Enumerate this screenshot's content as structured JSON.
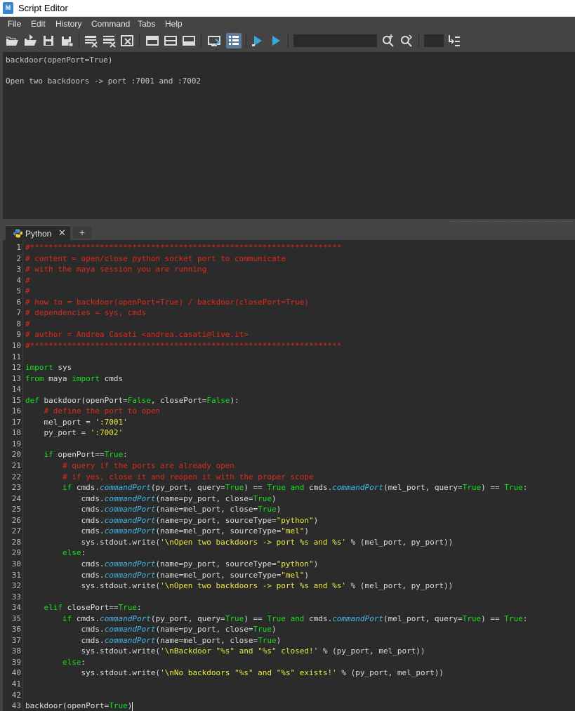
{
  "window": {
    "title": "Script Editor",
    "app_icon_letter": "M"
  },
  "menu": [
    "File",
    "Edit",
    "History",
    "Command",
    "Tabs",
    "Help"
  ],
  "toolbar": {
    "icons": [
      "open-script-icon",
      "source-script-icon",
      "save-script-icon",
      "save-as-icon",
      "clear-history-icon",
      "clear-input-icon",
      "clear-all-icon",
      "show-history-icon",
      "show-both-icon",
      "show-input-icon",
      "echo-all-commands-icon",
      "line-numbers-icon",
      "execute-all-icon",
      "execute-icon",
      "search-icon",
      "replace-icon",
      "goto-line-icon"
    ],
    "search_value": "",
    "goto_value": ""
  },
  "output": {
    "lines": [
      "backdoor(openPort=True)",
      "",
      "Open two backdoors -> port :7001 and :7002"
    ]
  },
  "tabs": {
    "active_label": "Python",
    "close_glyph": "✕",
    "add_glyph": "+"
  },
  "editor": {
    "line_numbers": [
      "1",
      "2",
      "3",
      "4",
      "5",
      "6",
      "7",
      "8",
      "9",
      "10",
      "11",
      "12",
      "13",
      "14",
      "15",
      "16",
      "17",
      "18",
      "19",
      "20",
      "21",
      "22",
      "23",
      "24",
      "25",
      "26",
      "27",
      "28",
      "29",
      "30",
      "31",
      "32",
      "33",
      "34",
      "35",
      "36",
      "37",
      "38",
      "39",
      "40",
      "41",
      "42",
      "43"
    ],
    "lines": [
      [
        [
          "c",
          "#*******************************************************************"
        ]
      ],
      [
        [
          "c",
          "# content = open/close python socket port to communicate"
        ]
      ],
      [
        [
          "c",
          "# with the maya session you are running"
        ]
      ],
      [
        [
          "c",
          "#"
        ]
      ],
      [
        [
          "c",
          "#"
        ]
      ],
      [
        [
          "c",
          "# how to = backdoor(openPort=True) / backdoor(closePort=True)"
        ]
      ],
      [
        [
          "c",
          "# dependencies = sys, cmds"
        ]
      ],
      [
        [
          "c",
          "#"
        ]
      ],
      [
        [
          "c",
          "# author = Andrea Casati <andrea.casati@live.it>"
        ]
      ],
      [
        [
          "c",
          "#*******************************************************************"
        ]
      ],
      [],
      [
        [
          "k",
          "import"
        ],
        [
          "t",
          " sys"
        ]
      ],
      [
        [
          "k",
          "from"
        ],
        [
          "t",
          " maya "
        ],
        [
          "k",
          "import"
        ],
        [
          "t",
          " cmds"
        ]
      ],
      [],
      [
        [
          "k",
          "def"
        ],
        [
          "t",
          " backdoor(openPort="
        ],
        [
          "k",
          "False"
        ],
        [
          "t",
          ", closePort="
        ],
        [
          "k",
          "False"
        ],
        [
          "t",
          "):"
        ]
      ],
      [
        [
          "t",
          "    "
        ],
        [
          "c",
          "# define the port to open"
        ]
      ],
      [
        [
          "t",
          "    mel_port = "
        ],
        [
          "s",
          "':7001'"
        ]
      ],
      [
        [
          "t",
          "    py_port = "
        ],
        [
          "s",
          "':7002'"
        ]
      ],
      [],
      [
        [
          "t",
          "    "
        ],
        [
          "k",
          "if"
        ],
        [
          "t",
          " openPort=="
        ],
        [
          "k",
          "True"
        ],
        [
          "t",
          ":"
        ]
      ],
      [
        [
          "t",
          "        "
        ],
        [
          "c",
          "# query if the ports are already open"
        ]
      ],
      [
        [
          "t",
          "        "
        ],
        [
          "c",
          "# if yes, close it and reopen it with the proper scope"
        ]
      ],
      [
        [
          "t",
          "        "
        ],
        [
          "k",
          "if"
        ],
        [
          "t",
          " cmds."
        ],
        [
          "f",
          "commandPort"
        ],
        [
          "t",
          "(py_port, query="
        ],
        [
          "k",
          "True"
        ],
        [
          "t",
          ") == "
        ],
        [
          "k",
          "True"
        ],
        [
          "t",
          " "
        ],
        [
          "k",
          "and"
        ],
        [
          "t",
          " cmds."
        ],
        [
          "f",
          "commandPort"
        ],
        [
          "t",
          "(mel_port, query="
        ],
        [
          "k",
          "True"
        ],
        [
          "t",
          ") == "
        ],
        [
          "k",
          "True"
        ],
        [
          "t",
          ":"
        ]
      ],
      [
        [
          "t",
          "            cmds."
        ],
        [
          "f",
          "commandPort"
        ],
        [
          "t",
          "(name=py_port, close="
        ],
        [
          "k",
          "True"
        ],
        [
          "t",
          ")"
        ]
      ],
      [
        [
          "t",
          "            cmds."
        ],
        [
          "f",
          "commandPort"
        ],
        [
          "t",
          "(name=mel_port, close="
        ],
        [
          "k",
          "True"
        ],
        [
          "t",
          ")"
        ]
      ],
      [
        [
          "t",
          "            cmds."
        ],
        [
          "f",
          "commandPort"
        ],
        [
          "t",
          "(name=py_port, sourceType="
        ],
        [
          "s",
          "\"python\""
        ],
        [
          "t",
          ")"
        ]
      ],
      [
        [
          "t",
          "            cmds."
        ],
        [
          "f",
          "commandPort"
        ],
        [
          "t",
          "(name=mel_port, sourceType="
        ],
        [
          "s",
          "\"mel\""
        ],
        [
          "t",
          ")"
        ]
      ],
      [
        [
          "t",
          "            sys.stdout.write("
        ],
        [
          "s",
          "'\\nOpen two backdoors -> port %s and %s'"
        ],
        [
          "t",
          " % (mel_port, py_port))"
        ]
      ],
      [
        [
          "t",
          "        "
        ],
        [
          "k",
          "else"
        ],
        [
          "t",
          ":"
        ]
      ],
      [
        [
          "t",
          "            cmds."
        ],
        [
          "f",
          "commandPort"
        ],
        [
          "t",
          "(name=py_port, sourceType="
        ],
        [
          "s",
          "\"python\""
        ],
        [
          "t",
          ")"
        ]
      ],
      [
        [
          "t",
          "            cmds."
        ],
        [
          "f",
          "commandPort"
        ],
        [
          "t",
          "(name=mel_port, sourceType="
        ],
        [
          "s",
          "\"mel\""
        ],
        [
          "t",
          ")"
        ]
      ],
      [
        [
          "t",
          "            sys.stdout.write("
        ],
        [
          "s",
          "'\\nOpen two backdoors -> port %s and %s'"
        ],
        [
          "t",
          " % (mel_port, py_port))"
        ]
      ],
      [],
      [
        [
          "t",
          "    "
        ],
        [
          "k",
          "elif"
        ],
        [
          "t",
          " closePort=="
        ],
        [
          "k",
          "True"
        ],
        [
          "t",
          ":"
        ]
      ],
      [
        [
          "t",
          "        "
        ],
        [
          "k",
          "if"
        ],
        [
          "t",
          " cmds."
        ],
        [
          "f",
          "commandPort"
        ],
        [
          "t",
          "(py_port, query="
        ],
        [
          "k",
          "True"
        ],
        [
          "t",
          ") == "
        ],
        [
          "k",
          "True"
        ],
        [
          "t",
          " "
        ],
        [
          "k",
          "and"
        ],
        [
          "t",
          " cmds."
        ],
        [
          "f",
          "commandPort"
        ],
        [
          "t",
          "(mel_port, query="
        ],
        [
          "k",
          "True"
        ],
        [
          "t",
          ") == "
        ],
        [
          "k",
          "True"
        ],
        [
          "t",
          ":"
        ]
      ],
      [
        [
          "t",
          "            cmds."
        ],
        [
          "f",
          "commandPort"
        ],
        [
          "t",
          "(name=py_port, close="
        ],
        [
          "k",
          "True"
        ],
        [
          "t",
          ")"
        ]
      ],
      [
        [
          "t",
          "            cmds."
        ],
        [
          "f",
          "commandPort"
        ],
        [
          "t",
          "(name=mel_port, close="
        ],
        [
          "k",
          "True"
        ],
        [
          "t",
          ")"
        ]
      ],
      [
        [
          "t",
          "            sys.stdout.write("
        ],
        [
          "s",
          "'\\nBackdoor \"%s\" and \"%s\" closed!'"
        ],
        [
          "t",
          " % (py_port, mel_port))"
        ]
      ],
      [
        [
          "t",
          "        "
        ],
        [
          "k",
          "else"
        ],
        [
          "t",
          ":"
        ]
      ],
      [
        [
          "t",
          "            sys.stdout.write("
        ],
        [
          "s",
          "'\\nNo backdoors \"%s\" and \"%s\" exists!'"
        ],
        [
          "t",
          " % (py_port, mel_port))"
        ]
      ],
      [],
      [],
      [
        [
          "t",
          "backdoor(openPort="
        ],
        [
          "k",
          "True"
        ],
        [
          "t",
          ")"
        ]
      ]
    ]
  },
  "colors": {
    "comment": "#e0291a",
    "keyword": "#14e018",
    "string": "#e8e845",
    "function": "#47b6e6",
    "text": "#dcdcdc",
    "background": "#2b2b2b",
    "panel": "#444444"
  }
}
